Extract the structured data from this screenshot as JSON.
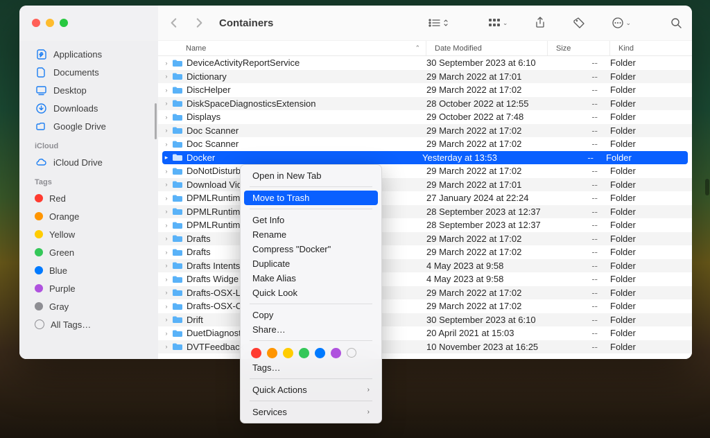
{
  "window": {
    "title": "Containers"
  },
  "sidebar": {
    "favorites": [
      {
        "label": "Applications",
        "icon": "apps"
      },
      {
        "label": "Documents",
        "icon": "doc"
      },
      {
        "label": "Desktop",
        "icon": "desktop"
      },
      {
        "label": "Downloads",
        "icon": "downloads"
      },
      {
        "label": "Google Drive",
        "icon": "gdrive"
      }
    ],
    "icloud_head": "iCloud",
    "icloud": [
      {
        "label": "iCloud Drive",
        "icon": "cloud"
      }
    ],
    "tags_head": "Tags",
    "tags": [
      {
        "label": "Red",
        "color": "red"
      },
      {
        "label": "Orange",
        "color": "orange"
      },
      {
        "label": "Yellow",
        "color": "yellow"
      },
      {
        "label": "Green",
        "color": "green"
      },
      {
        "label": "Blue",
        "color": "blue"
      },
      {
        "label": "Purple",
        "color": "purple"
      },
      {
        "label": "Gray",
        "color": "gray"
      }
    ],
    "all_tags": "All Tags…"
  },
  "columns": {
    "name": "Name",
    "date": "Date Modified",
    "size": "Size",
    "kind": "Kind"
  },
  "size_placeholder": "--",
  "kind_folder": "Folder",
  "rows": [
    {
      "name": "DeviceActivityReportService",
      "date": "30 September 2023 at 6:10",
      "selected": false
    },
    {
      "name": "Dictionary",
      "date": "29 March 2022 at 17:01",
      "selected": false
    },
    {
      "name": "DiscHelper",
      "date": "29 March 2022 at 17:02",
      "selected": false
    },
    {
      "name": "DiskSpaceDiagnosticsExtension",
      "date": "28 October 2022 at 12:55",
      "selected": false
    },
    {
      "name": "Displays",
      "date": "29 October 2022 at 7:48",
      "selected": false
    },
    {
      "name": "Doc Scanner",
      "date": "29 March 2022 at 17:02",
      "selected": false
    },
    {
      "name": "Doc Scanner",
      "date": "29 March 2022 at 17:02",
      "selected": false
    },
    {
      "name": "Docker",
      "date": "Yesterday at 13:53",
      "selected": true
    },
    {
      "name": "DoNotDisturb",
      "date": "29 March 2022 at 17:02",
      "selected": false
    },
    {
      "name": "Download Vid",
      "date": "29 March 2022 at 17:01",
      "selected": false
    },
    {
      "name": "DPMLRuntim",
      "date": "27 January 2024 at 22:24",
      "selected": false
    },
    {
      "name": "DPMLRuntim",
      "date": "28 September 2023 at 12:37",
      "selected": false
    },
    {
      "name": "DPMLRuntim",
      "date": "28 September 2023 at 12:37",
      "selected": false
    },
    {
      "name": "Drafts",
      "date": "29 March 2022 at 17:02",
      "selected": false
    },
    {
      "name": "Drafts",
      "date": "29 March 2022 at 17:02",
      "selected": false
    },
    {
      "name": "Drafts Intents",
      "date": "4 May 2023 at 9:58",
      "selected": false
    },
    {
      "name": "Drafts Widge",
      "date": "4 May 2023 at 9:58",
      "selected": false
    },
    {
      "name": "Drafts-OSX-L",
      "date": "29 March 2022 at 17:02",
      "selected": false
    },
    {
      "name": "Drafts-OSX-C",
      "date": "29 March 2022 at 17:02",
      "selected": false
    },
    {
      "name": "Drift",
      "date": "30 September 2023 at 6:10",
      "selected": false
    },
    {
      "name": "DuetDiagnost",
      "date": "20 April 2021 at 15:03",
      "selected": false
    },
    {
      "name": "DVTFeedback",
      "date": "10 November 2023 at 16:25",
      "selected": false
    }
  ],
  "context_menu": {
    "items": [
      {
        "label": "Open in New Tab"
      },
      {
        "sep": true
      },
      {
        "label": "Move to Trash",
        "highlight": true
      },
      {
        "sep": true
      },
      {
        "label": "Get Info"
      },
      {
        "label": "Rename"
      },
      {
        "label": "Compress \"Docker\""
      },
      {
        "label": "Duplicate"
      },
      {
        "label": "Make Alias"
      },
      {
        "label": "Quick Look"
      },
      {
        "sep": true
      },
      {
        "label": "Copy"
      },
      {
        "label": "Share…"
      },
      {
        "sep": true
      },
      {
        "tag_picker": true
      },
      {
        "label": "Tags…"
      },
      {
        "sep": true
      },
      {
        "label": "Quick Actions",
        "submenu": true
      },
      {
        "sep": true
      },
      {
        "label": "Services",
        "submenu": true
      }
    ],
    "tag_colors": [
      "#ff3b30",
      "#ff9500",
      "#ffcc00",
      "#34c759",
      "#007aff",
      "#af52de"
    ]
  }
}
